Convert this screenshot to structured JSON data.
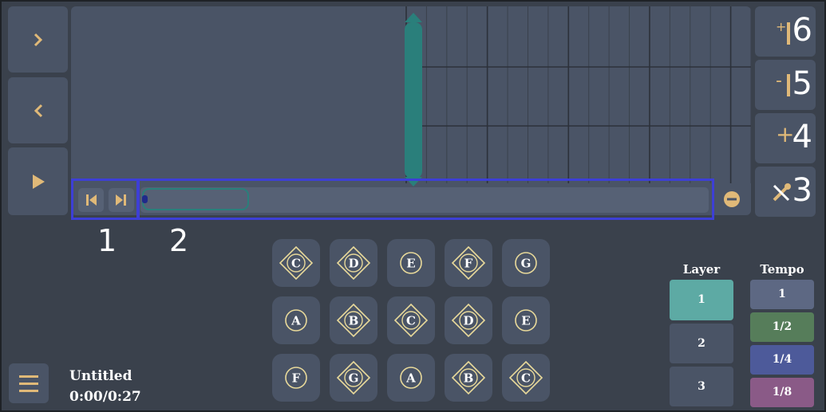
{
  "colors": {
    "background": "#3a414c",
    "tile": "#4a5466",
    "accent_teal": "#2a7f7b",
    "gold": "#e0b978",
    "layer_active": "#5daaa4",
    "tempo_1": "#5d6883",
    "tempo_1_2": "#567d5a",
    "tempo_1_4": "#4d5a9a",
    "tempo_1_8": "#8a5a87",
    "highlight": "#3d3fd6"
  },
  "nav": {
    "forward_icon": "chevron-right-icon",
    "back_icon": "chevron-left-icon",
    "play_icon": "play-icon"
  },
  "side_buttons": [
    {
      "sign": "+",
      "number": "6"
    },
    {
      "sign": "-",
      "number": "5"
    },
    {
      "sign": "+",
      "number": "4"
    },
    {
      "sign": "tools-icon",
      "number": "3"
    }
  ],
  "timeline": {
    "skip_start_icon": "skip-start-icon",
    "skip_end_icon": "skip-end-icon",
    "remove_icon": "minus-circle-icon",
    "progress": 0.16
  },
  "annotations": {
    "label_1": "1",
    "label_2": "2"
  },
  "notes": [
    [
      {
        "letter": "C",
        "diamond": true
      },
      {
        "letter": "D",
        "diamond": true
      },
      {
        "letter": "E",
        "diamond": false
      },
      {
        "letter": "F",
        "diamond": true
      },
      {
        "letter": "G",
        "diamond": false
      }
    ],
    [
      {
        "letter": "A",
        "diamond": false
      },
      {
        "letter": "B",
        "diamond": true
      },
      {
        "letter": "C",
        "diamond": true
      },
      {
        "letter": "D",
        "diamond": true
      },
      {
        "letter": "E",
        "diamond": false
      }
    ],
    [
      {
        "letter": "F",
        "diamond": false
      },
      {
        "letter": "G",
        "diamond": true
      },
      {
        "letter": "A",
        "diamond": false
      },
      {
        "letter": "B",
        "diamond": true
      },
      {
        "letter": "C",
        "diamond": true
      }
    ]
  ],
  "layer": {
    "title": "Layer",
    "options": [
      "1",
      "2",
      "3"
    ],
    "selected": "1"
  },
  "tempo": {
    "title": "Tempo",
    "options": [
      "1",
      "1/2",
      "1/4",
      "1/8"
    ]
  },
  "song": {
    "title": "Untitled",
    "time": "0:00/0:27",
    "menu_icon": "hamburger-menu-icon"
  }
}
